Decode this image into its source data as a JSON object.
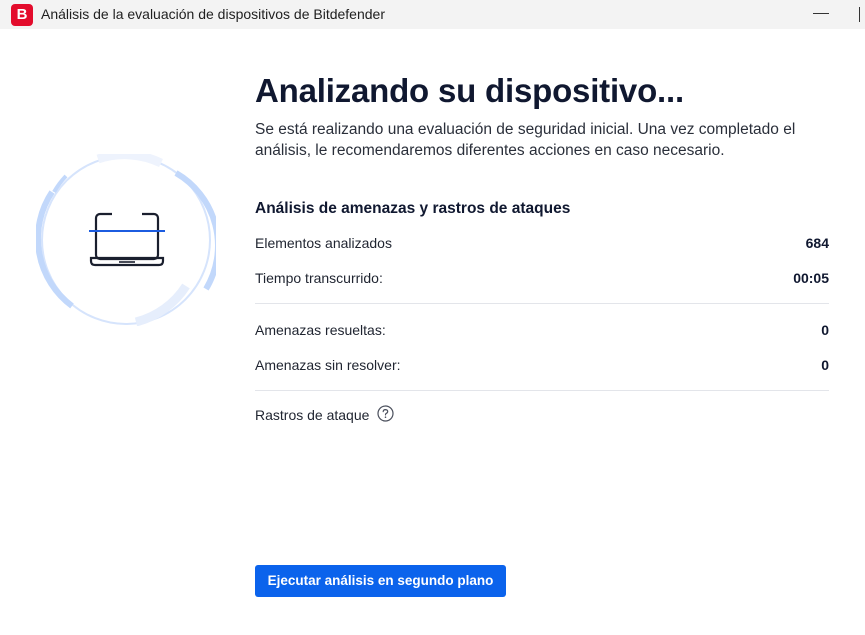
{
  "window": {
    "title": "Análisis de la evaluación de dispositivos de Bitdefender",
    "logo_letter": "B",
    "logo_color": "#e30c2c"
  },
  "main": {
    "headline": "Analizando su dispositivo...",
    "subtitle": "Se está realizando una evaluación de seguridad inicial. Una vez completado el análisis, le recomendaremos diferentes acciones en caso necesario.",
    "section_title": "Análisis de amenazas y rastros de ataques",
    "stats": {
      "scanned_label": "Elementos analizados",
      "scanned_value": "684",
      "elapsed_label": "Tiempo transcurrido:",
      "elapsed_value": "00:05",
      "resolved_label": "Amenazas resueltas:",
      "resolved_value": "0",
      "unresolved_label": "Amenazas sin resolver:",
      "unresolved_value": "0"
    },
    "attack_traces_label": "Rastros de ataque",
    "help_icon": "question-circle-icon",
    "illustration_icon": "laptop-scan-icon",
    "background_button_label": "Ejecutar análisis en segundo plano"
  },
  "colors": {
    "accent": "#0b63ec",
    "ring": "#c6dafc",
    "title_bar": "#f3f3f3"
  }
}
